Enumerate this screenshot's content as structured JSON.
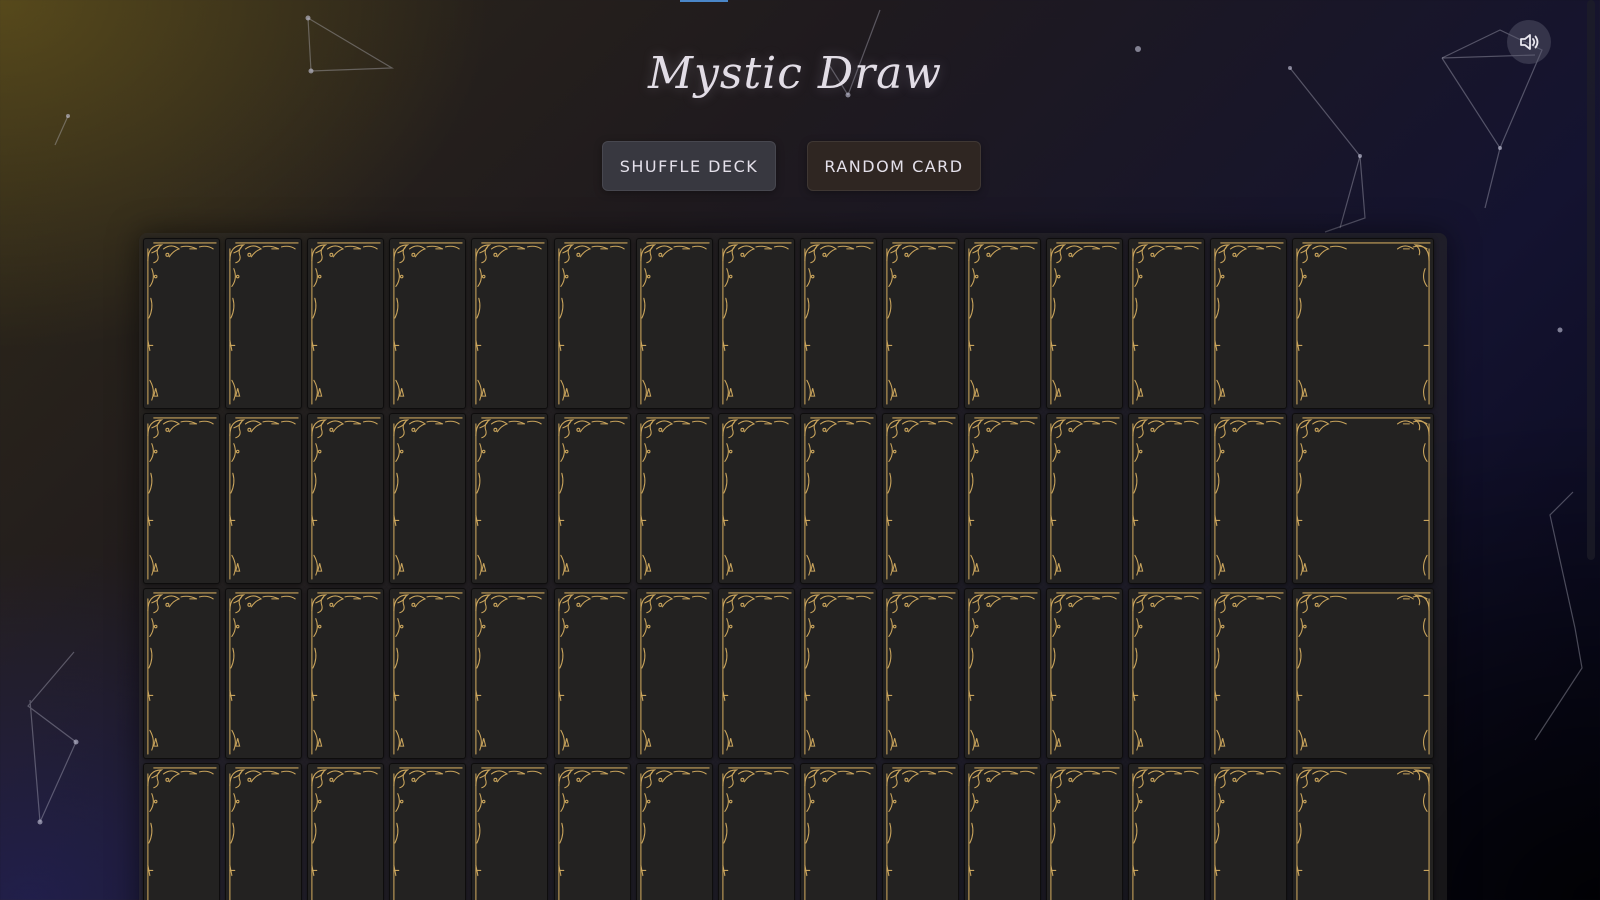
{
  "app": {
    "title": "Mystic Draw"
  },
  "controls": {
    "shuffle_label": "SHUFFLE DECK",
    "random_label": "RANDOM CARD",
    "sound_icon": "speaker-volume-icon"
  },
  "deck": {
    "rows_visible": 4,
    "columns": 15,
    "card_back": "ornate-gold-filigree",
    "colors": {
      "gold": "#c9a45c",
      "card_face": "#232221"
    }
  },
  "theme": {
    "accent": "#4a86c8",
    "text": "#e2dde6"
  }
}
